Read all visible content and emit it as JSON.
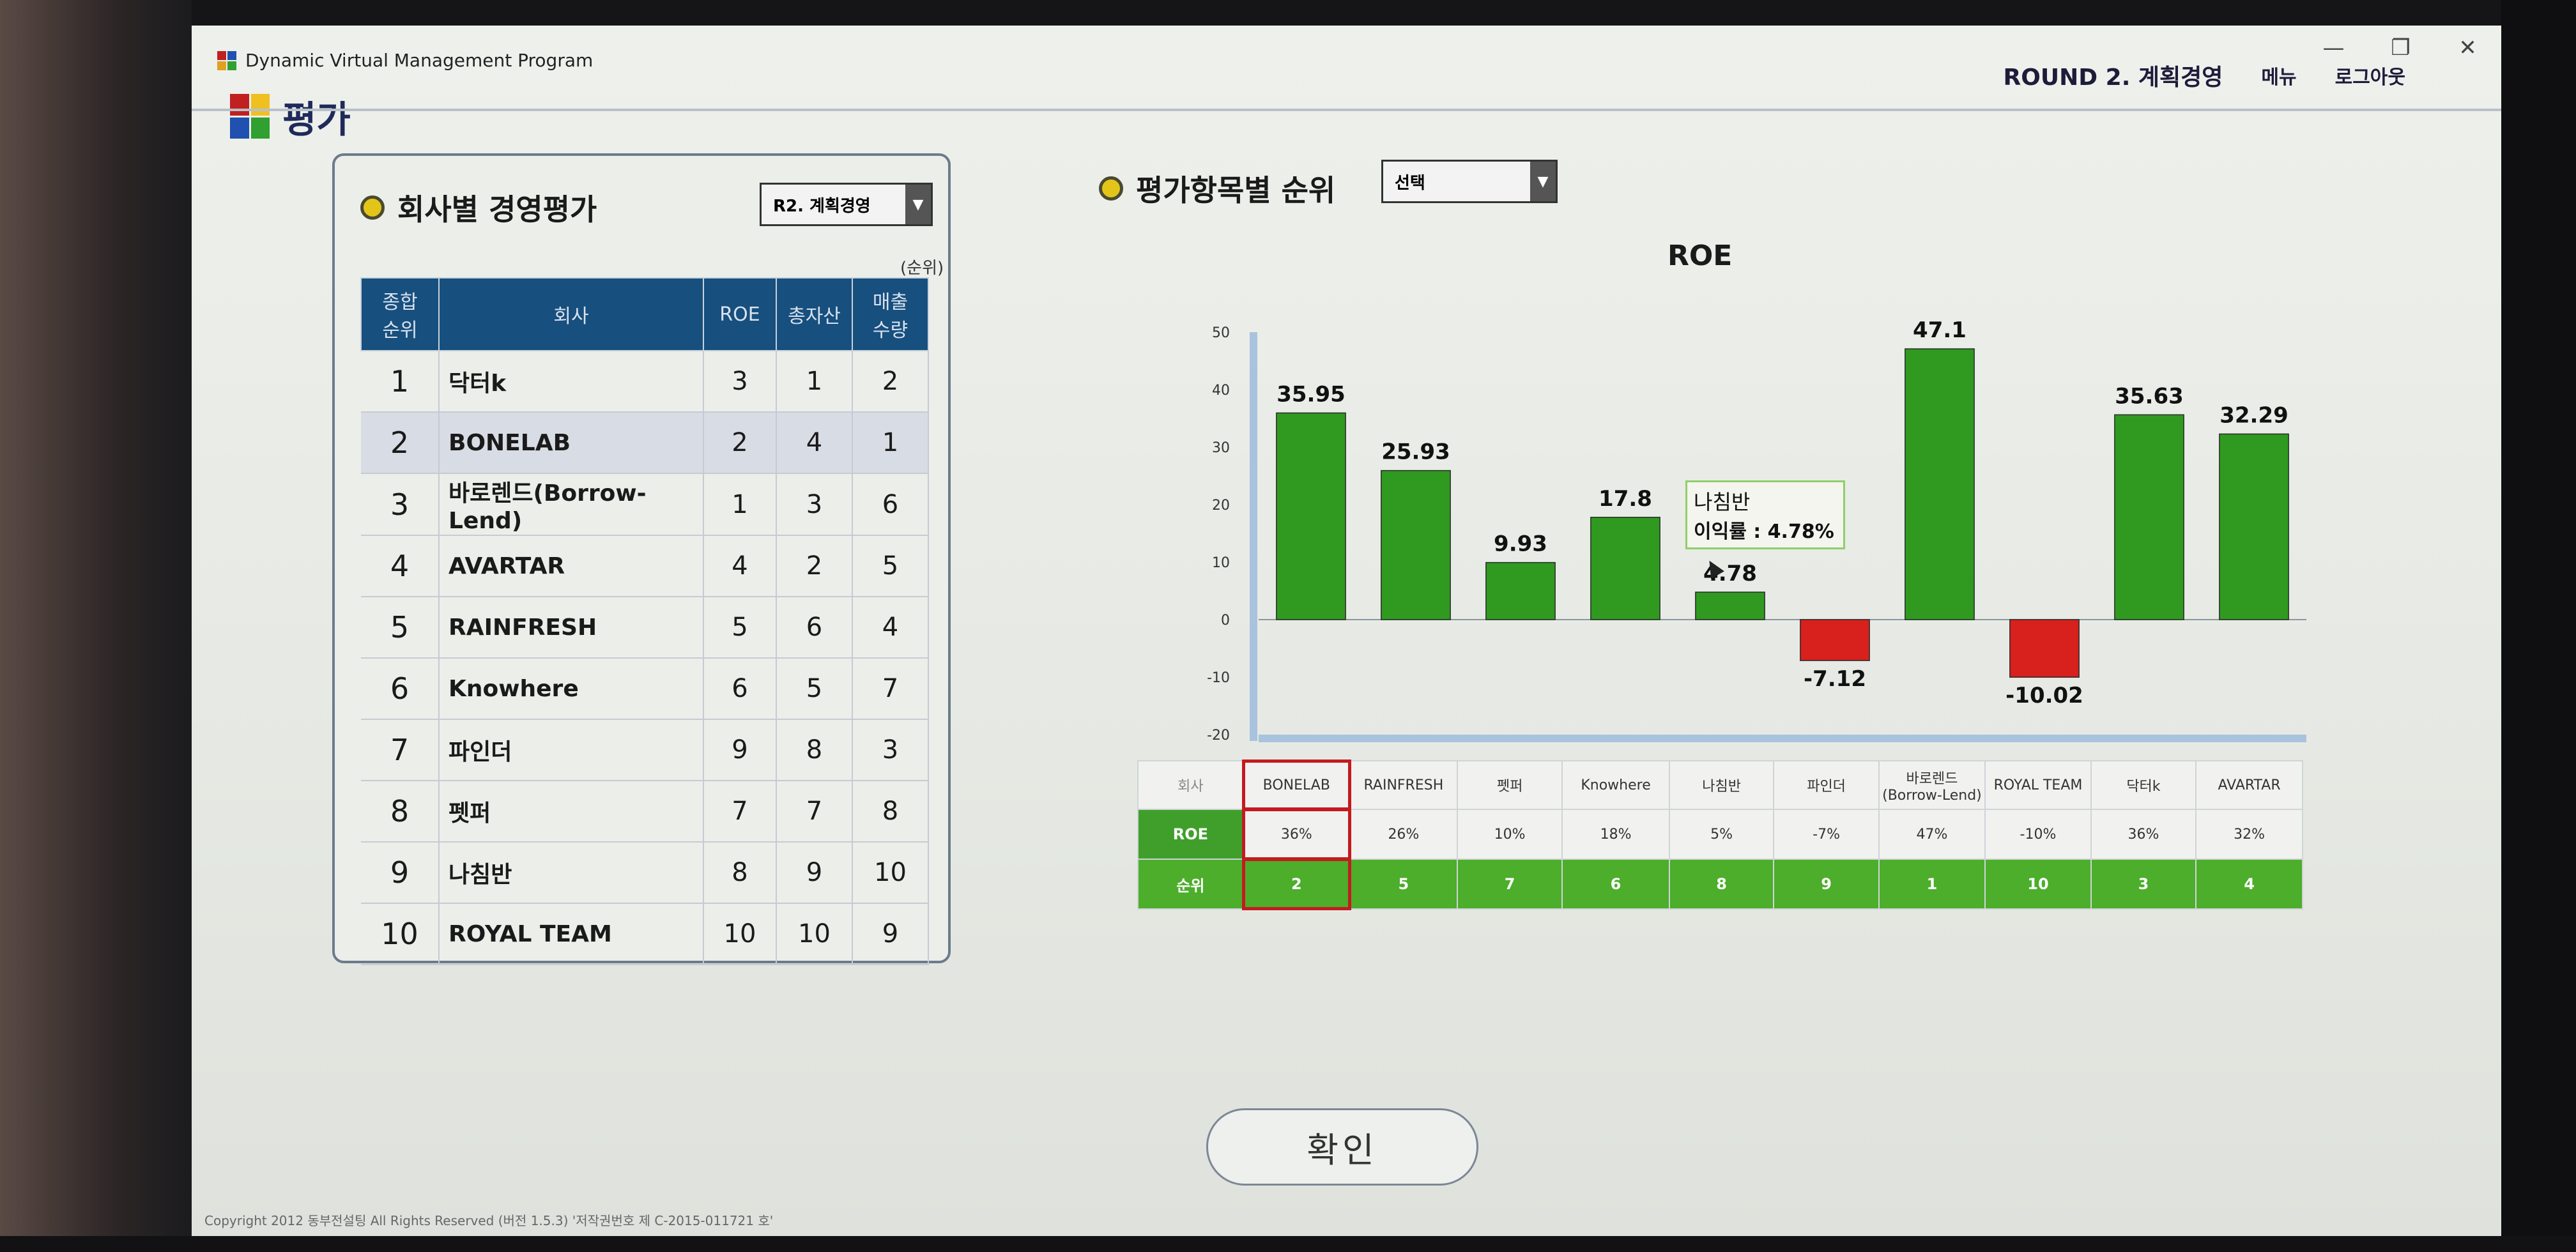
{
  "window": {
    "title": "Dynamic Virtual Management Program",
    "controls": [
      "—",
      "❐",
      "✕"
    ]
  },
  "header": {
    "round": "ROUND 2. 계획경영",
    "menu": "메뉴",
    "logout": "로그아웃"
  },
  "page": {
    "title": "평가"
  },
  "left": {
    "title": "회사별 경영평가",
    "dropdown": "R2. 계획경영",
    "rank_note": "(순위)",
    "headers": [
      "종합\n순위",
      "회사",
      "ROE",
      "총자산",
      "매출\n수량"
    ],
    "rows": [
      {
        "rank": "1",
        "company": "닥터k",
        "roe": "3",
        "assets": "1",
        "sales": "2"
      },
      {
        "rank": "2",
        "company": "BONELAB",
        "roe": "2",
        "assets": "4",
        "sales": "1"
      },
      {
        "rank": "3",
        "company": "바로렌드(Borrow-Lend)",
        "roe": "1",
        "assets": "3",
        "sales": "6"
      },
      {
        "rank": "4",
        "company": "AVARTAR",
        "roe": "4",
        "assets": "2",
        "sales": "5"
      },
      {
        "rank": "5",
        "company": "RAINFRESH",
        "roe": "5",
        "assets": "6",
        "sales": "4"
      },
      {
        "rank": "6",
        "company": "Knowhere",
        "roe": "6",
        "assets": "5",
        "sales": "7"
      },
      {
        "rank": "7",
        "company": "파인더",
        "roe": "9",
        "assets": "8",
        "sales": "3"
      },
      {
        "rank": "8",
        "company": "펫퍼",
        "roe": "7",
        "assets": "7",
        "sales": "8"
      },
      {
        "rank": "9",
        "company": "나침반",
        "roe": "8",
        "assets": "9",
        "sales": "10"
      },
      {
        "rank": "10",
        "company": "ROYAL TEAM",
        "roe": "10",
        "assets": "10",
        "sales": "9"
      }
    ]
  },
  "right": {
    "title": "평가항목별 순위",
    "dropdown": "선택"
  },
  "chart_data": {
    "type": "bar",
    "title": "ROE",
    "categories": [
      "BONELAB",
      "RAINFRESH",
      "펫퍼",
      "Knowhere",
      "나침반",
      "파인더",
      "바로렌드(Borrow-Lend)",
      "ROYAL TEAM",
      "닥터k",
      "AVARTAR"
    ],
    "values": [
      35.95,
      25.93,
      9.93,
      17.8,
      4.78,
      -7.12,
      47.1,
      -10.02,
      35.63,
      32.29
    ],
    "labels": [
      "35.95",
      "25.93",
      "9.93",
      "17.8",
      "4.78",
      "-7.12",
      "47.1",
      "-10.02",
      "35.63",
      "32.29"
    ],
    "yticks": [
      50,
      40,
      30,
      20,
      10,
      0,
      -10,
      -20
    ],
    "ylim": [
      -20,
      50
    ],
    "positive_color": "#2f9a1f",
    "negative_color": "#d8201c",
    "grid": false
  },
  "tooltip": {
    "title": "나침반",
    "text": "이익률 : 4.78%"
  },
  "summary": {
    "corner": "회사",
    "companies": [
      "BONELAB",
      "RAINFRESH",
      "펫퍼",
      "Knowhere",
      "나침반",
      "파인더",
      "바로렌드\n(Borrow-Lend)",
      "ROYAL TEAM",
      "닥터k",
      "AVARTAR"
    ],
    "roe_label": "ROE",
    "roe": [
      "36%",
      "26%",
      "10%",
      "18%",
      "5%",
      "-7%",
      "47%",
      "-10%",
      "36%",
      "32%"
    ],
    "rank_label": "순위",
    "ranks": [
      "2",
      "5",
      "7",
      "6",
      "8",
      "9",
      "1",
      "10",
      "3",
      "4"
    ]
  },
  "confirm": "확인",
  "footer": "Copyright 2012 동부전설팅 All Rights Reserved (버전 1.5.3) '저작권번호 제 C-2015-011721 호'"
}
